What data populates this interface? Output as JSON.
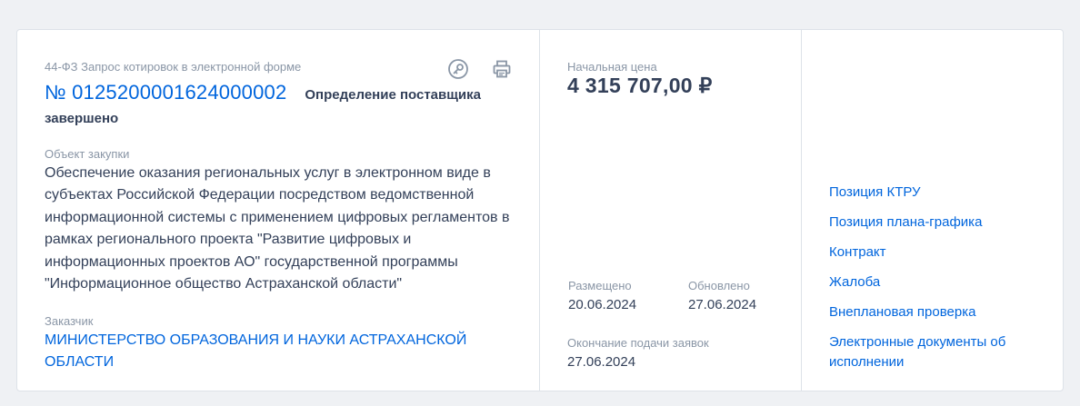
{
  "card": {
    "law_type": "44-ФЗ Запрос котировок в электронной форме",
    "reg_number": "№ 0125200001624000002",
    "status": "Определение поставщика завершено",
    "object_label": "Объект закупки",
    "object_text": "Обеспечение оказания региональных услуг в электронном виде в субъектах Российской Федерации посредством ведомственной информационной системы с применением цифровых регламентов в рамках регионального проекта \"Развитие цифровых и информационных проектов АО\" государственной программы \"Информационное общество Астраханской области\"",
    "customer_label": "Заказчик",
    "customer_name": "МИНИСТЕРСТВО ОБРАЗОВАНИЯ И НАУКИ АСТРАХАНСКОЙ ОБЛАСТИ",
    "icons": {
      "key": "key-icon",
      "print": "print-icon"
    }
  },
  "price": {
    "label": "Начальная цена",
    "value": "4 315 707,00 ₽"
  },
  "dates": {
    "posted_label": "Размещено",
    "posted_value": "20.06.2024",
    "updated_label": "Обновлено",
    "updated_value": "27.06.2024",
    "deadline_label": "Окончание подачи заявок",
    "deadline_value": "27.06.2024"
  },
  "links": [
    "Позиция КТРУ",
    "Позиция плана-графика",
    "Контракт",
    "Жалоба",
    "Внеплановая проверка",
    "Электронные документы об исполнении"
  ],
  "colors": {
    "accent": "#0065dd",
    "text": "#334059",
    "muted": "#8a96a6",
    "background": "#eff1f4"
  }
}
